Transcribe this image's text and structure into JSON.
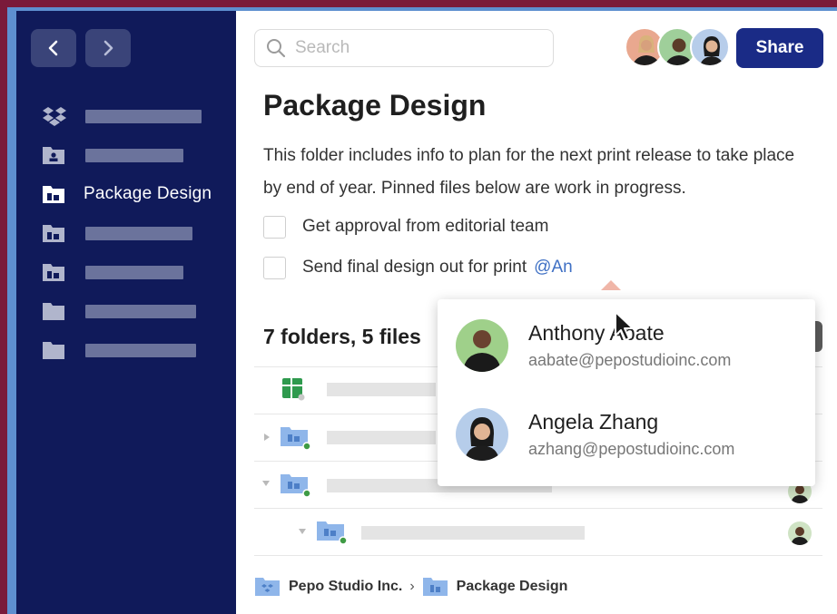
{
  "sidebar": {
    "back_icon": "chevron-left-icon",
    "forward_icon": "chevron-right-icon",
    "items": [
      {
        "icon": "dropbox-icon",
        "label": ""
      },
      {
        "icon": "user-folder-icon",
        "label": ""
      },
      {
        "icon": "team-folder-icon",
        "label": "Package Design",
        "active": true
      },
      {
        "icon": "team-folder-icon",
        "label": ""
      },
      {
        "icon": "team-folder-icon",
        "label": ""
      },
      {
        "icon": "folder-icon",
        "label": ""
      },
      {
        "icon": "folder-icon",
        "label": ""
      }
    ]
  },
  "header": {
    "search_placeholder": "Search",
    "share_label": "Share"
  },
  "folder": {
    "title": "Package Design",
    "description": "This folder includes info to plan for the next print release to take place by end of year. Pinned files below are work in progress.",
    "tasks": [
      {
        "label": "Get approval from editorial team",
        "checked": false
      },
      {
        "label": "Send final design out for print",
        "mention": "@An",
        "checked": false
      }
    ],
    "count_label": "7 folders, 5 files"
  },
  "mention_popup": {
    "people": [
      {
        "name": "Anthony Abate",
        "email": "aabate@pepostudioinc.com"
      },
      {
        "name": "Angela Zhang",
        "email": "azhang@pepostudioinc.com"
      }
    ]
  },
  "breadcrumb": {
    "root": "Pepo Studio Inc.",
    "separator": "›",
    "current": "Package Design"
  },
  "colors": {
    "sidebar": "#101a5a",
    "accent": "#1a2b86",
    "mention": "#3f70c4"
  }
}
